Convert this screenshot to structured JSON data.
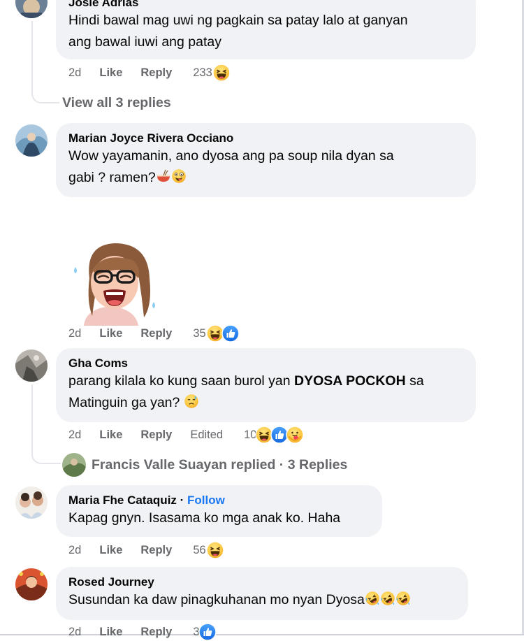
{
  "comments": [
    {
      "author": "Josie Adrias",
      "text_line1": "Hindi bawal mag uwi ng pagkain sa patay lalo at ganyan",
      "text_line2": "ang bawal iuwi ang patay",
      "time": "2d",
      "like": "Like",
      "reply": "Reply",
      "reaction_count": "233",
      "reactions": [
        "haha"
      ],
      "view_replies": "View all 3 replies"
    },
    {
      "author": "Marian Joyce Rivera Occiano",
      "text_line1": "Wow yayamanin, ano dyosa ang pa soup nila dyan sa",
      "text_line2": "gabi ? ramen?",
      "inline_emojis": [
        "ramen-bowl",
        "zany-face"
      ],
      "sticker": "avatar-laughing-sticker",
      "time": "2d",
      "like": "Like",
      "reply": "Reply",
      "reaction_count": "35",
      "reactions": [
        "haha",
        "like"
      ]
    },
    {
      "author": "Gha Coms",
      "text_line1_plain": "parang kilala ko kung saan burol yan ",
      "text_line1_bold": "DYOSA POCKOH",
      "text_line1_tail": " sa",
      "text_line2": "Matinguin ga yan?",
      "inline_emojis": [
        "sad-sweat-face"
      ],
      "time": "2d",
      "like": "Like",
      "reply": "Reply",
      "edited": "Edited",
      "reaction_count": "10",
      "reactions": [
        "haha",
        "like",
        "care"
      ],
      "replied_by": "Francis Valle Suayan replied",
      "replied_sep": " · ",
      "replied_count": "3 Replies"
    },
    {
      "author": "Maria Fhe Cataquiz",
      "follow_sep": " · ",
      "follow": "Follow",
      "text_line1": "Kapag gnyn. Isasama ko mga anak ko. Haha",
      "time": "2d",
      "like": "Like",
      "reply": "Reply",
      "reaction_count": "56",
      "reactions": [
        "haha"
      ]
    },
    {
      "author": "Rosed Journey",
      "text_line1": "Susundan ka daw pinagkuhanan mo nyan Dyosa",
      "inline_emojis": [
        "rofl",
        "rofl",
        "rofl"
      ],
      "time": "2d",
      "like": "Like",
      "reply": "Reply",
      "reaction_count": "3",
      "reactions": [
        "like"
      ]
    }
  ],
  "colors": {
    "bubble": "#f0f2f5",
    "secondary_text": "#65676b",
    "primary_text": "#050505",
    "link_blue": "#1877f2",
    "thread_line": "#e4e6eb"
  }
}
